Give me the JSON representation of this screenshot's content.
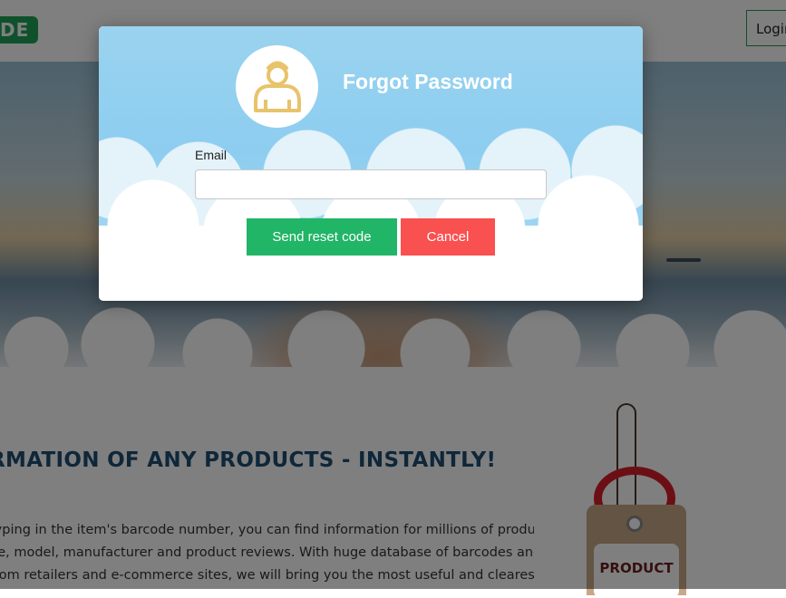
{
  "header": {
    "logo_text": "DE",
    "login_label": "Login"
  },
  "content": {
    "headline": "RMATION OF ANY PRODUCTS - INSTANTLY!",
    "paragraph_lines": [
      "typing in the item's barcode number, you can find information for millions of products on",
      "ne,  model,  manufacturer  and  product  reviews.  With  huge  database  of  barcodes  and",
      "from retailers and e-commerce sites, we will bring you the most useful and clearest info"
    ],
    "tag_text": "PRODUCT"
  },
  "modal": {
    "title": "Forgot Password",
    "email_label": "Email",
    "email_value": "",
    "send_label": "Send reset code",
    "cancel_label": "Cancel"
  },
  "colors": {
    "accent_green": "#21b567",
    "cancel_red": "#f95050",
    "avatar_icon": "#e8c36a",
    "headline_blue": "#1c4e73"
  },
  "icons": {
    "avatar": "user-icon"
  }
}
